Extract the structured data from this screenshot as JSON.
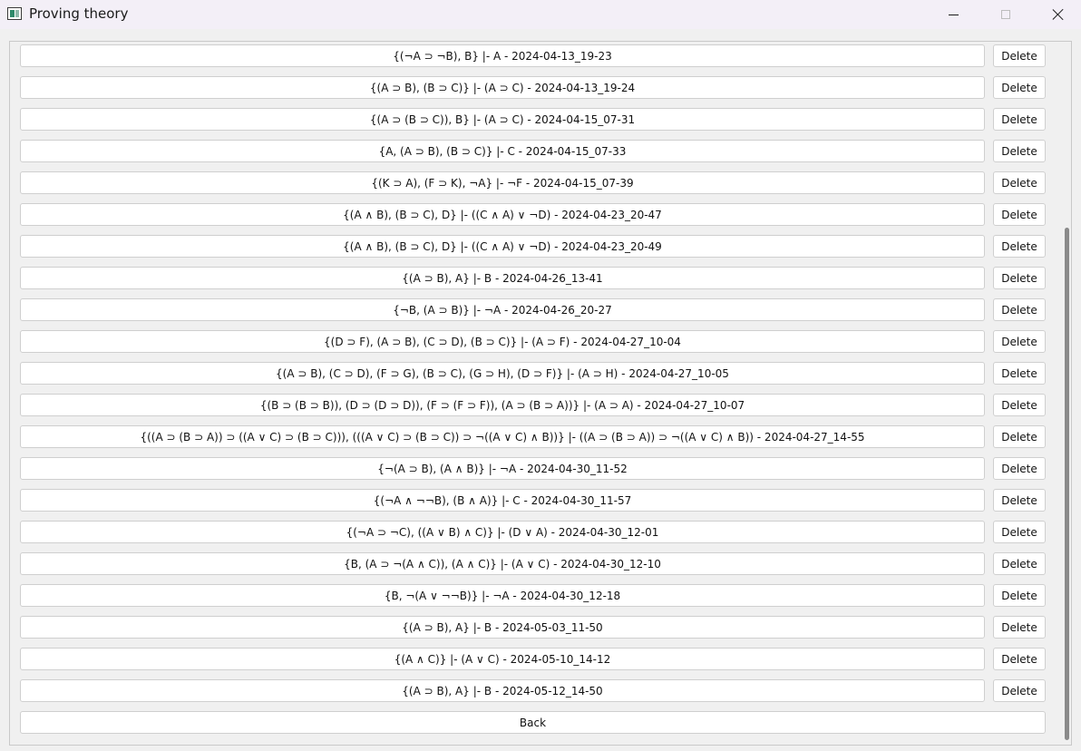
{
  "window": {
    "title": "Proving theory"
  },
  "entries": [
    {
      "text": "{(¬A ⊃ ¬B), B} |- A - 2024-04-13_19-23",
      "delete_label": "Delete"
    },
    {
      "text": "{(A ⊃ B), (B ⊃ C)} |- (A ⊃ C) - 2024-04-13_19-24",
      "delete_label": "Delete"
    },
    {
      "text": "{(A ⊃ (B ⊃ C)), B} |- (A ⊃ C) - 2024-04-15_07-31",
      "delete_label": "Delete"
    },
    {
      "text": "{A, (A ⊃ B), (B ⊃ C)} |- C - 2024-04-15_07-33",
      "delete_label": "Delete"
    },
    {
      "text": "{(K ⊃ A), (F ⊃ K), ¬A} |- ¬F - 2024-04-15_07-39",
      "delete_label": "Delete"
    },
    {
      "text": "{(A ∧ B), (B ⊃ C), D} |- ((C ∧ A) ∨ ¬D) - 2024-04-23_20-47",
      "delete_label": "Delete"
    },
    {
      "text": "{(A ∧ B), (B ⊃ C), D} |- ((C ∧ A) ∨ ¬D) - 2024-04-23_20-49",
      "delete_label": "Delete"
    },
    {
      "text": "{(A ⊃ B), A} |- B - 2024-04-26_13-41",
      "delete_label": "Delete"
    },
    {
      "text": "{¬B, (A ⊃ B)} |- ¬A - 2024-04-26_20-27",
      "delete_label": "Delete"
    },
    {
      "text": "{(D ⊃ F), (A ⊃ B), (C ⊃ D), (B ⊃ C)} |- (A ⊃ F) - 2024-04-27_10-04",
      "delete_label": "Delete"
    },
    {
      "text": "{(A ⊃ B), (C ⊃ D), (F ⊃ G), (B ⊃ C), (G ⊃ H), (D ⊃ F)} |- (A ⊃ H) - 2024-04-27_10-05",
      "delete_label": "Delete"
    },
    {
      "text": "{(B ⊃ (B ⊃ B)), (D ⊃ (D ⊃ D)), (F ⊃ (F ⊃ F)), (A ⊃ (B ⊃ A))} |- (A ⊃ A) - 2024-04-27_10-07",
      "delete_label": "Delete"
    },
    {
      "text": "{((A ⊃ (B ⊃ A)) ⊃ ((A ∨ C) ⊃ (B ⊃ C))), (((A ∨ C) ⊃ (B ⊃ C)) ⊃ ¬((A ∨ C) ∧ B))} |- ((A ⊃ (B ⊃ A)) ⊃ ¬((A ∨ C) ∧ B)) - 2024-04-27_14-55",
      "delete_label": "Delete"
    },
    {
      "text": "{¬(A ⊃ B), (A ∧ B)} |- ¬A - 2024-04-30_11-52",
      "delete_label": "Delete"
    },
    {
      "text": "{(¬A ∧ ¬¬B), (B ∧ A)} |- C - 2024-04-30_11-57",
      "delete_label": "Delete"
    },
    {
      "text": "{(¬A ⊃ ¬C), ((A ∨ B) ∧ C)} |- (D ∨ A) - 2024-04-30_12-01",
      "delete_label": "Delete"
    },
    {
      "text": "{B, (A ⊃ ¬(A ∧ C)), (A ∧ C)} |- (A ∨ C) - 2024-04-30_12-10",
      "delete_label": "Delete"
    },
    {
      "text": "{B, ¬(A ∨ ¬¬B)} |- ¬A - 2024-04-30_12-18",
      "delete_label": "Delete"
    },
    {
      "text": "{(A ⊃ B), A} |- B - 2024-05-03_11-50",
      "delete_label": "Delete"
    },
    {
      "text": "{(A ∧ C)} |- (A ∨ C) - 2024-05-10_14-12",
      "delete_label": "Delete"
    },
    {
      "text": "{(A ⊃ B), A} |- B - 2024-05-12_14-50",
      "delete_label": "Delete"
    }
  ],
  "footer": {
    "back_label": "Back"
  },
  "icons": {
    "app": "app-window-icon",
    "minimize": "minimize-icon",
    "maximize": "maximize-icon",
    "close": "close-icon"
  }
}
